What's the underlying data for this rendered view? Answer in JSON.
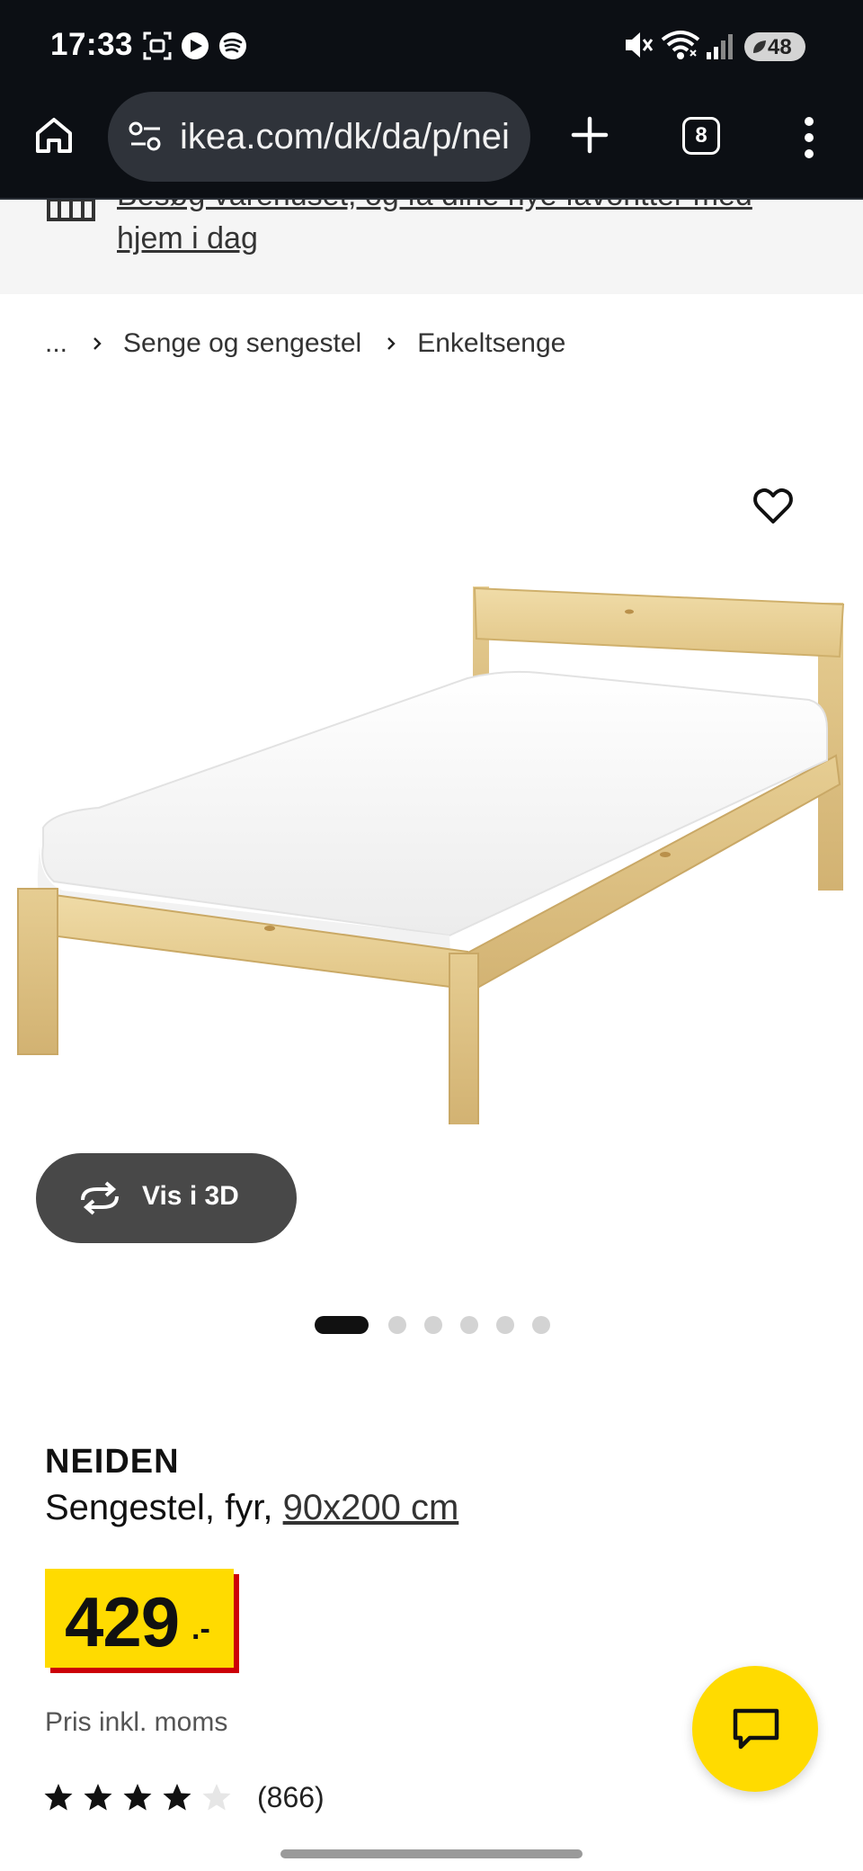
{
  "status_bar": {
    "time": "17:33",
    "battery": "48",
    "left_icons": [
      "screen-recorder-icon",
      "media-app-icon",
      "spotify-icon"
    ],
    "right_icons": [
      "mute-icon",
      "wifi-icon",
      "signal-icon",
      "battery-icon"
    ]
  },
  "browser": {
    "url": "ikea.com/dk/da/p/nei",
    "tab_count": "8"
  },
  "banner": {
    "line1": "Besøg varehuset, og få dine nye favoritter med",
    "line2": "hjem i dag"
  },
  "breadcrumb": {
    "ellipsis": "...",
    "items": [
      "Senge og sengestel",
      "Enkeltsenge"
    ]
  },
  "media": {
    "view_3d_label": "Vis i 3D",
    "image_count": 6,
    "active_index": 0
  },
  "product": {
    "name": "NEIDEN",
    "description": "Sengestel, fyr, ",
    "size": "90x200 cm",
    "price": "429",
    "price_suffix": ".-",
    "vat_note": "Pris inkl. moms",
    "rating": 4,
    "rating_max": 5,
    "review_count": "(866)"
  },
  "colors": {
    "price_yellow": "#ffdb00",
    "price_red": "#cc0008",
    "chrome_dark": "#0c0f14"
  }
}
